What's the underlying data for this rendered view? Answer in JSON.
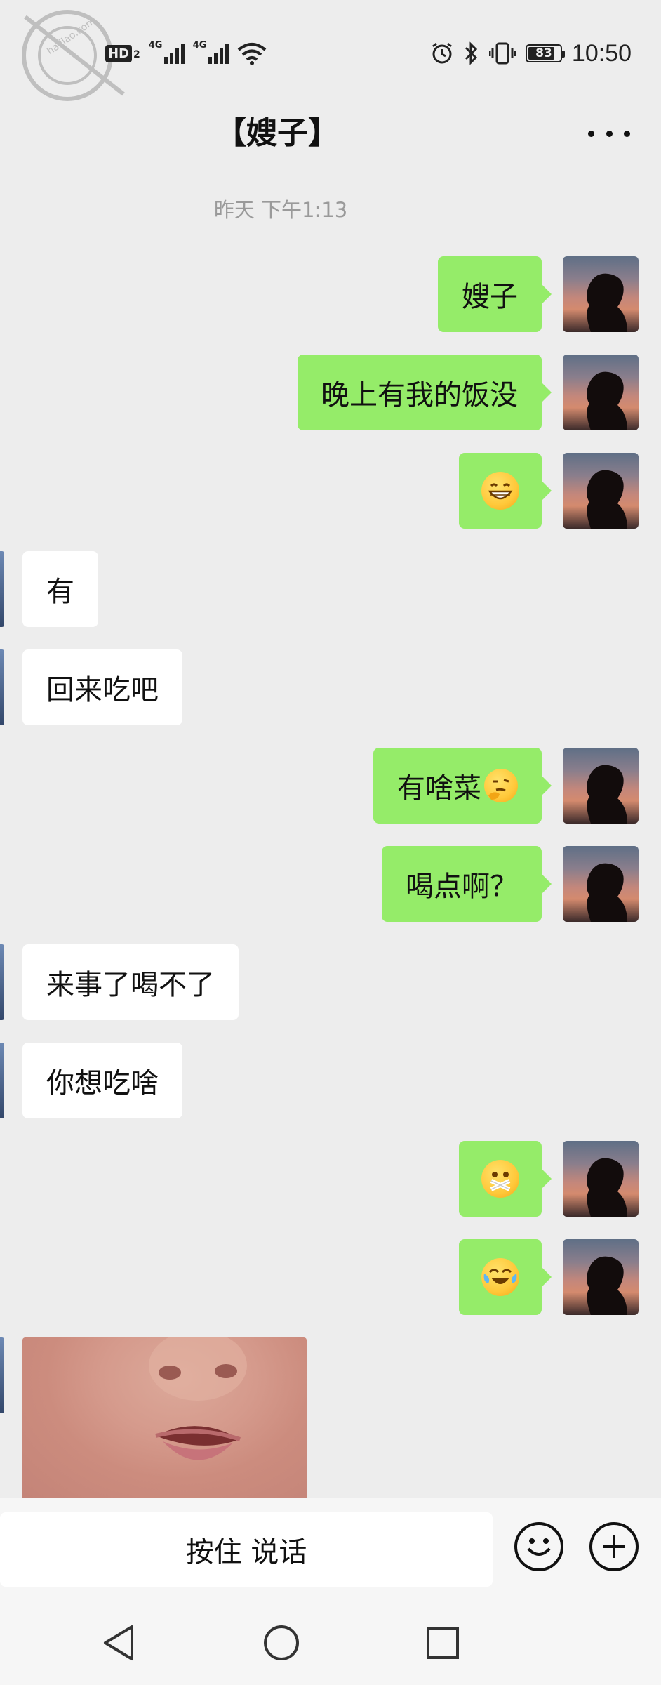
{
  "status_bar": {
    "watermark_text": "海角社区 haijiao.com",
    "hd_label": "HD",
    "hd_sub": "2",
    "network_1": "4G",
    "network_2": "4G",
    "battery_percent": "83",
    "battery_level": 0.83,
    "time": "10:50"
  },
  "header": {
    "title": "【嫂子】",
    "more_icon": "more-dots-icon"
  },
  "chat": {
    "timestamp": "昨天 下午1:13",
    "messages": [
      {
        "side": "out",
        "text": "嫂子"
      },
      {
        "side": "out",
        "text": "晚上有我的饭没"
      },
      {
        "side": "out",
        "emoji": "grinning-emoji"
      },
      {
        "side": "in",
        "text": "有"
      },
      {
        "side": "in",
        "text": "回来吃吧"
      },
      {
        "side": "out",
        "text": "有啥菜",
        "emoji": "thinking-emoji"
      },
      {
        "side": "out",
        "text": "喝点啊？"
      },
      {
        "side": "in",
        "text": "来事了喝不了"
      },
      {
        "side": "in",
        "text": "你想吃啥"
      },
      {
        "side": "out",
        "emoji": "zipper-mouth-emoji"
      },
      {
        "side": "out",
        "emoji": "laughing-tears-emoji"
      },
      {
        "side": "in",
        "image": "baby-face-photo"
      }
    ]
  },
  "input_bar": {
    "voice_label": "按住 说话",
    "emoji_icon": "smiley-face-icon",
    "plus_icon": "plus-circle-icon"
  },
  "nav_bar": {
    "back_icon": "triangle-back-icon",
    "home_icon": "circle-home-icon",
    "recents_icon": "square-recents-icon"
  },
  "colors": {
    "outgoing_bubble": "#95ec69",
    "incoming_bubble": "#ffffff",
    "background": "#ededed"
  }
}
